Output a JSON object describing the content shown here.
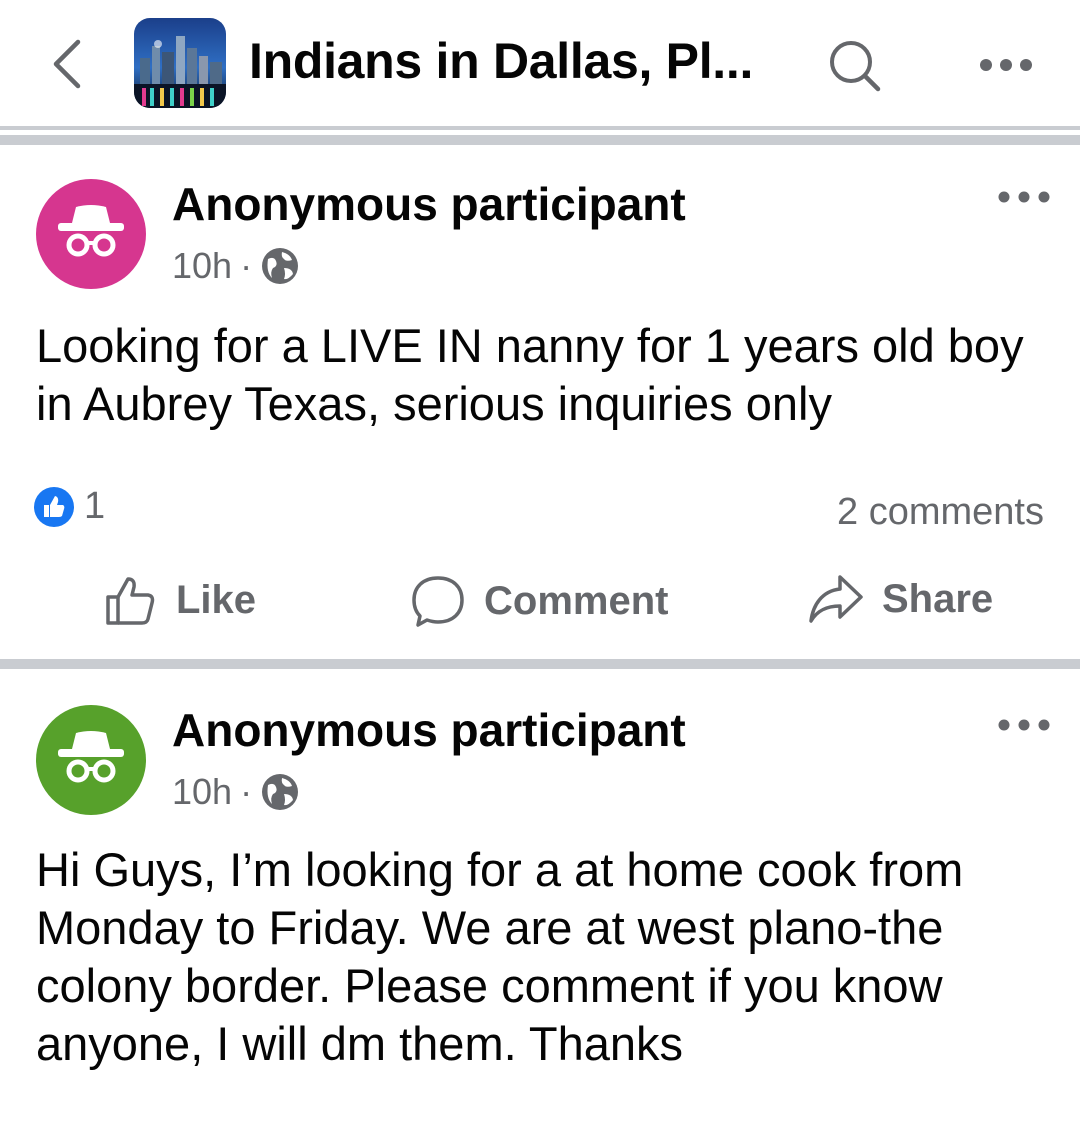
{
  "header": {
    "title": "Indians in Dallas, Pl...",
    "back_icon": "chevron-left-icon",
    "search_icon": "search-icon",
    "more_icon": "more-horizontal-icon"
  },
  "posts": [
    {
      "author": "Anonymous participant",
      "avatar_color": "#d6368f",
      "time": "10h",
      "separator": "·",
      "privacy_icon": "globe-icon",
      "text": "Looking for a LIVE IN nanny for 1 years old boy in Aubrey Texas, serious inquiries only",
      "reaction_count": "1",
      "comments": "2 comments",
      "actions": {
        "like": "Like",
        "comment": "Comment",
        "share": "Share"
      }
    },
    {
      "author": "Anonymous participant",
      "avatar_color": "#57a12b",
      "time": "10h",
      "separator": "·",
      "privacy_icon": "globe-icon",
      "text": "Hi Guys, I’m looking for a at home cook from Monday to Friday. We are at west plano-the colony border. Please comment if you know anyone, I will dm them. Thanks"
    }
  ],
  "colors": {
    "like_blue": "#1877f2",
    "secondary_text": "#65676b",
    "divider": "#c9ccd1"
  }
}
